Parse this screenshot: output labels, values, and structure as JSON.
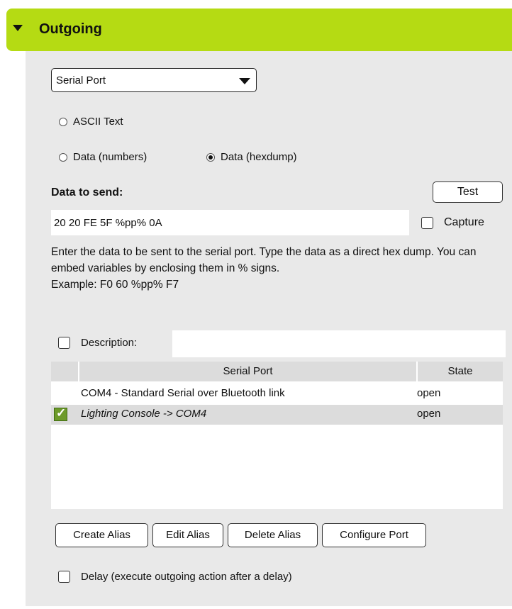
{
  "header": {
    "title": "Outgoing"
  },
  "output_type": {
    "selected": "Serial Port"
  },
  "radios": {
    "ascii": "ASCII Text",
    "numbers": "Data (numbers)",
    "hexdump": "Data (hexdump)",
    "selected": "hexdump"
  },
  "data_section": {
    "label": "Data to send:",
    "test_button": "Test",
    "value": "20 20 FE 5F %pp% 0A",
    "capture_label": "Capture"
  },
  "help": {
    "text": "Enter the data to be sent to the serial port. Type the data as a direct hex dump. You can embed variables by enclosing them in % signs.",
    "example": "Example: F0 60 %pp% F7"
  },
  "description": {
    "label": "Description:",
    "value": ""
  },
  "table": {
    "headers": {
      "port": "Serial Port",
      "state": "State"
    },
    "rows": [
      {
        "port": "COM4 - Standard Serial over Bluetooth link",
        "state": "open",
        "checked": false
      },
      {
        "port": "Lighting Console -> COM4",
        "state": "open",
        "checked": true
      }
    ]
  },
  "buttons": {
    "create_alias": "Create Alias",
    "edit_alias": "Edit Alias",
    "delete_alias": "Delete Alias",
    "configure_port": "Configure Port"
  },
  "delay": {
    "label": "Delay (execute outgoing action after a delay)"
  },
  "colors": {
    "header_bg": "#b5db13",
    "panel_bg": "#e9e9e9",
    "check_green": "#6d9a2a"
  }
}
